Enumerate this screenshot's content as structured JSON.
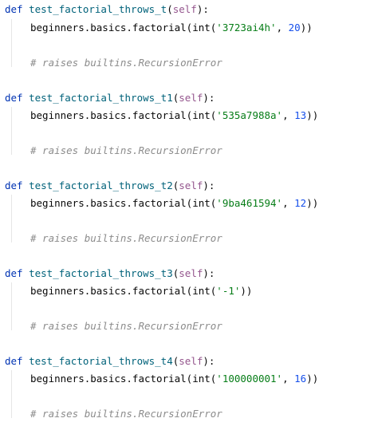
{
  "functions": [
    {
      "def_kw": "def",
      "name": "test_factorial_throws_t",
      "open_paren": "(",
      "self_kw": "self",
      "close_sig": "):",
      "call_prefix": "beginners.basics.factorial(int(",
      "str_arg": "'3723ai4h'",
      "sep": ", ",
      "num_arg": "20",
      "call_suffix": "))",
      "comment": "# raises builtins.RecursionError"
    },
    {
      "def_kw": "def",
      "name": "test_factorial_throws_t1",
      "open_paren": "(",
      "self_kw": "self",
      "close_sig": "):",
      "call_prefix": "beginners.basics.factorial(int(",
      "str_arg": "'535a7988a'",
      "sep": ", ",
      "num_arg": "13",
      "call_suffix": "))",
      "comment": "# raises builtins.RecursionError"
    },
    {
      "def_kw": "def",
      "name": "test_factorial_throws_t2",
      "open_paren": "(",
      "self_kw": "self",
      "close_sig": "):",
      "call_prefix": "beginners.basics.factorial(int(",
      "str_arg": "'9ba461594'",
      "sep": ", ",
      "num_arg": "12",
      "call_suffix": "))",
      "comment": "# raises builtins.RecursionError"
    },
    {
      "def_kw": "def",
      "name": "test_factorial_throws_t3",
      "open_paren": "(",
      "self_kw": "self",
      "close_sig": "):",
      "call_prefix": "beginners.basics.factorial(int(",
      "str_arg": "'-1'",
      "sep": "",
      "num_arg": "",
      "call_suffix": "))",
      "comment": "# raises builtins.RecursionError"
    },
    {
      "def_kw": "def",
      "name": "test_factorial_throws_t4",
      "open_paren": "(",
      "self_kw": "self",
      "close_sig": "):",
      "call_prefix": "beginners.basics.factorial(int(",
      "str_arg": "'100000001'",
      "sep": ", ",
      "num_arg": "16",
      "call_suffix": "))",
      "comment": "# raises builtins.RecursionError"
    }
  ]
}
